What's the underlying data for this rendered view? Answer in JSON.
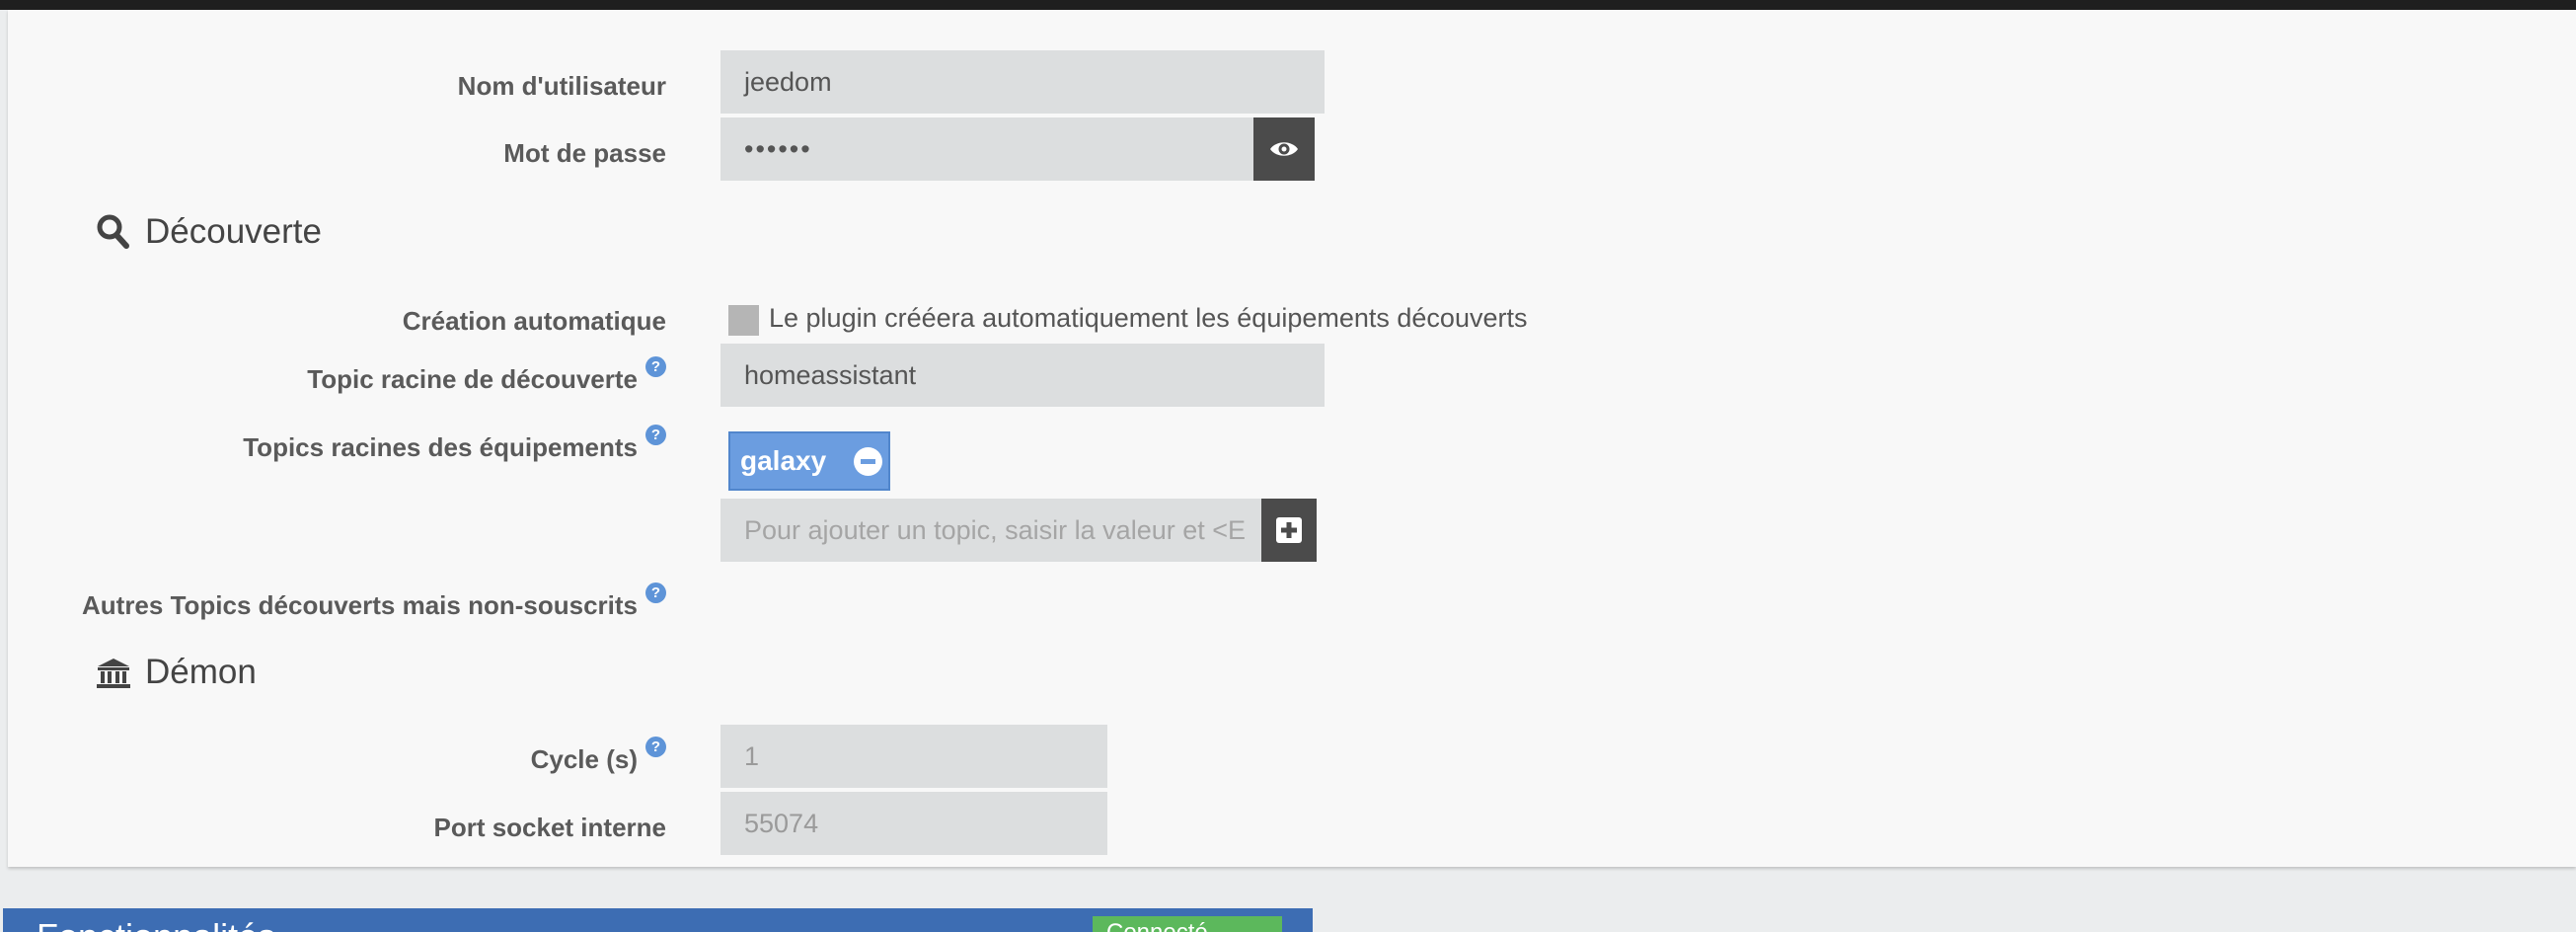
{
  "auth": {
    "username_label": "Nom d'utilisateur",
    "username_value": "jeedom",
    "password_label": "Mot de passe",
    "password_value": "••••••"
  },
  "discovery": {
    "title": "Découverte",
    "auto_create_label": "Création automatique",
    "auto_create_text": "Le plugin crééera automatiquement les équipements découverts",
    "root_topic_label": "Topic racine de découverte",
    "root_topic_value": "homeassistant",
    "equipment_topics_label": "Topics racines des équipements",
    "equipment_topics": [
      "galaxy"
    ],
    "add_topic_placeholder": "Pour ajouter un topic, saisir la valeur et <E",
    "other_topics_label": "Autres Topics découverts mais non-souscrits"
  },
  "daemon": {
    "title": "Démon",
    "cycle_label": "Cycle (s)",
    "cycle_value": "1",
    "port_label": "Port socket interne",
    "port_value": "55074"
  },
  "bottom_panel": {
    "title": "Fonctionnalités",
    "button_label": "Connecté"
  },
  "help_icon_glyph": "?",
  "colors": {
    "accent": "#6b9de0",
    "help": "#5e94d8",
    "panel_header": "#3d6db3",
    "success": "#5cb85c"
  }
}
